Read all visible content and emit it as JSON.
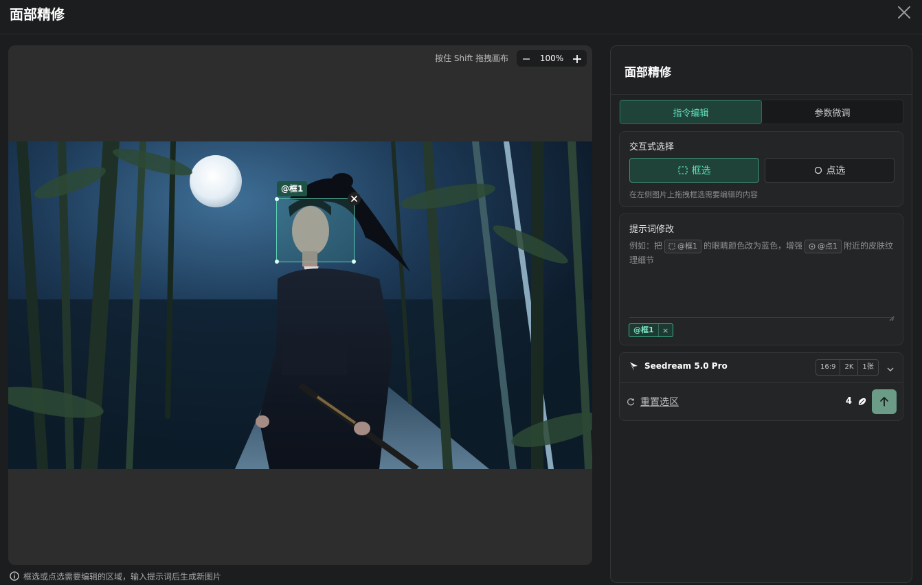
{
  "header": {
    "title": "面部精修"
  },
  "canvas": {
    "hint": "按住 Shift 拖拽画布",
    "zoom": "100%",
    "selection_tag": "@框1"
  },
  "footer": {
    "hint": "框选或点选需要编辑的区域，输入提示词后生成新图片"
  },
  "panel": {
    "title": "面部精修",
    "tabs": [
      {
        "label": "指令编辑"
      },
      {
        "label": "参数微调"
      }
    ],
    "interactive": {
      "title": "交互式选择",
      "box_label": "框选",
      "point_label": "点选",
      "note": "在左侧图片上拖拽框选需要编辑的内容"
    },
    "prompt": {
      "title": "提示词修改",
      "p1": "例如：把",
      "chip1": "@框1",
      "p2": "的眼睛颜色改为蓝色，增强",
      "chip2": "@点1",
      "p3": "附近的皮肤纹理细节",
      "ref_tag": "@框1",
      "ref_remove": "×"
    },
    "model": {
      "name": "Seedream 5.0 Pro",
      "params": [
        "16:9",
        "2K",
        "1张"
      ],
      "reset_label": "重置选区",
      "credits": "4"
    }
  },
  "colors": {
    "accent": "#5fe0bd",
    "accent_bg": "#1f4338",
    "submit": "#6b9c88"
  }
}
